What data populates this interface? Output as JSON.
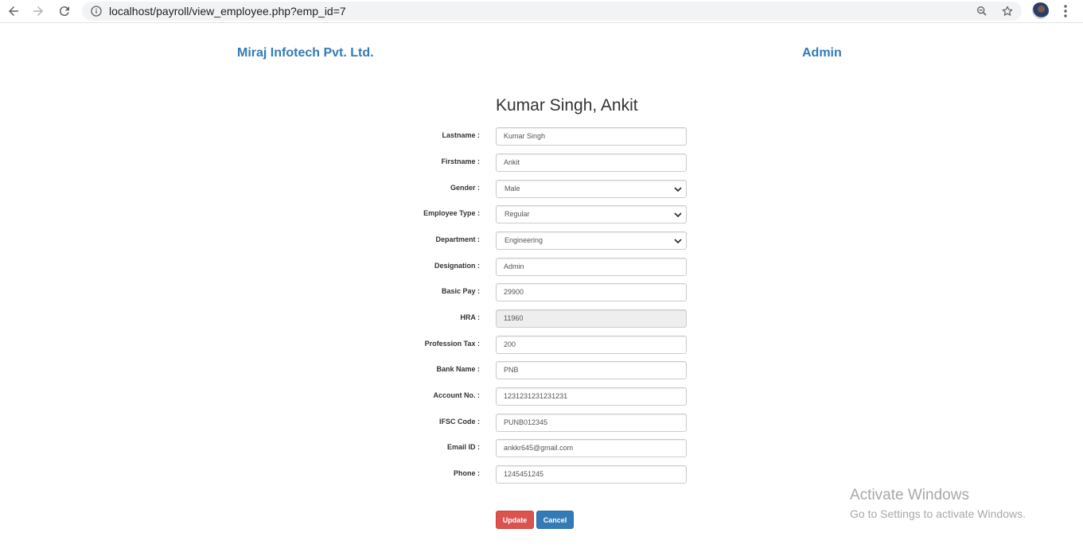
{
  "browser": {
    "url": "localhost/payroll/view_employee.php?emp_id=7"
  },
  "header": {
    "company": "Miraj Infotech Pvt. Ltd.",
    "user": "Admin"
  },
  "employee": {
    "title": "Kumar Singh, Ankit"
  },
  "form": {
    "fields": [
      {
        "label": "Lastname :",
        "value": "Kumar Singh",
        "type": "text"
      },
      {
        "label": "Firstname :",
        "value": "Ankit",
        "type": "text"
      },
      {
        "label": "Gender :",
        "value": "Male",
        "type": "select"
      },
      {
        "label": "Employee Type :",
        "value": "Regular",
        "type": "select"
      },
      {
        "label": "Department :",
        "value": "Engineering",
        "type": "select"
      },
      {
        "label": "Designation :",
        "value": "Admin",
        "type": "text"
      },
      {
        "label": "Basic Pay :",
        "value": "29900",
        "type": "text"
      },
      {
        "label": "HRA :",
        "value": "11960",
        "type": "readonly"
      },
      {
        "label": "Profession Tax :",
        "value": "200",
        "type": "text"
      },
      {
        "label": "Bank Name :",
        "value": "PNB",
        "type": "text"
      },
      {
        "label": "Account No. :",
        "value": "1231231231231231",
        "type": "text"
      },
      {
        "label": "IFSC Code :",
        "value": "PUNB012345",
        "type": "text"
      },
      {
        "label": "Email ID :",
        "value": "ankkr645@gmail.com",
        "type": "text"
      },
      {
        "label": "Phone :",
        "value": "1245451245",
        "type": "text"
      }
    ],
    "update_label": "Update",
    "cancel_label": "Cancel"
  },
  "watermark": {
    "line1": "Activate Windows",
    "line2": "Go to Settings to activate Windows."
  },
  "colors": {
    "link": "#337ab7",
    "danger": "#d9534f",
    "primary": "#337ab7"
  }
}
